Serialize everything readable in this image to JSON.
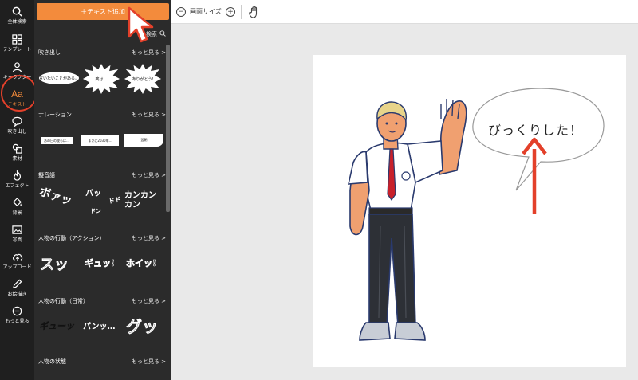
{
  "rail": {
    "items": [
      {
        "label": "全体検索",
        "icon": "search-icon"
      },
      {
        "label": "テンプレート",
        "icon": "template-grid-icon"
      },
      {
        "label": "キャラクター",
        "icon": "person-icon"
      },
      {
        "label": "テキスト",
        "icon": "text-aa-icon",
        "glyph": "Aa",
        "active": true
      },
      {
        "label": "吹き出し",
        "icon": "speech-bubble-icon"
      },
      {
        "label": "素材",
        "icon": "shapes-icon"
      },
      {
        "label": "エフェクト",
        "icon": "flame-icon"
      },
      {
        "label": "背景",
        "icon": "paint-bucket-icon"
      },
      {
        "label": "写真",
        "icon": "photo-icon"
      },
      {
        "label": "アップロード",
        "icon": "upload-cloud-icon"
      },
      {
        "label": "お絵描き",
        "icon": "pen-icon"
      },
      {
        "label": "もっと見る",
        "icon": "more-circle-icon"
      }
    ]
  },
  "panel": {
    "add_button": "＋テキスト追加",
    "search_label": "検索",
    "sections": [
      {
        "title": "吹き出し",
        "more": "もっと見る >"
      },
      {
        "title": "ナレーション",
        "more": "もっと見る >"
      },
      {
        "title": "擬音語",
        "more": "もっと見る >"
      },
      {
        "title": "人物の行動（アクション）",
        "more": "もっと見る >"
      },
      {
        "title": "人物の行動（日常）",
        "more": "もっと見る >"
      },
      {
        "title": "人物の状態",
        "more": "もっと見る >"
      }
    ],
    "bubbles": [
      "言いたいことがある。",
      "笑は…",
      "ありがとう!"
    ],
    "narrations": [
      "あの日の彼らは…",
      "まさに2030年…",
      "翌朝"
    ],
    "onomatopoeia": [
      "ボァッ",
      "バッ",
      "ドド",
      "ドン",
      "カンカンカン"
    ],
    "action": [
      "スッ",
      "ギュッ!",
      "ホイッ!"
    ],
    "daily": [
      "ギューッ",
      "パンッ…",
      "グッ"
    ]
  },
  "toolbar": {
    "zoom_out": "−",
    "screen_size_label": "画面サイズ",
    "zoom_in": "+"
  },
  "canvas": {
    "speech_text": "びっくりした！"
  },
  "colors": {
    "accent": "#f38b3c",
    "annotation": "#e3402a",
    "panel_bg": "#2b2b2b",
    "rail_bg": "#1f1f1f"
  }
}
